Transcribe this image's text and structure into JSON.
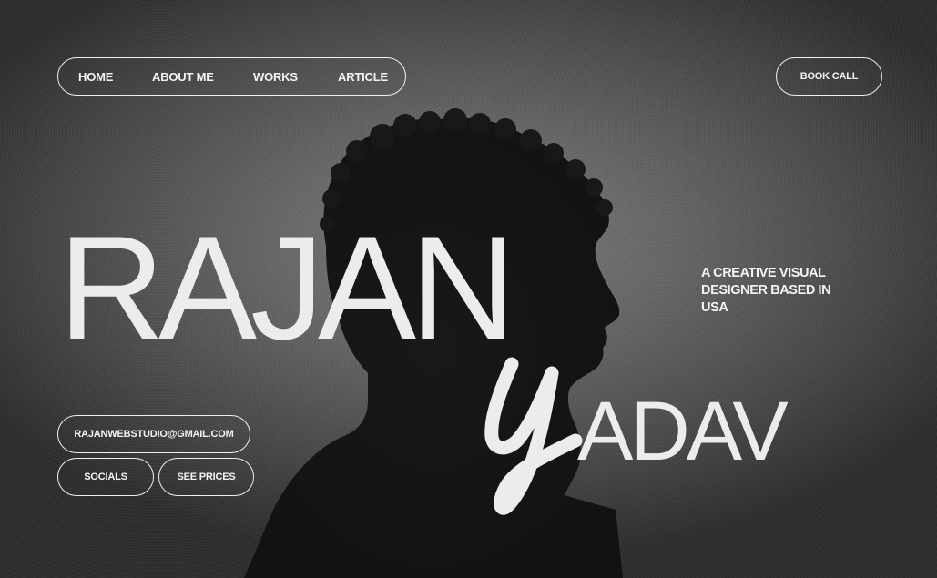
{
  "nav": {
    "items": [
      {
        "label": "HOME"
      },
      {
        "label": "ABOUT ME"
      },
      {
        "label": "WORKS"
      },
      {
        "label": "ARTICLE"
      }
    ],
    "cta_label": "BOOK CALL"
  },
  "hero": {
    "first_name": "RAJAN",
    "last_name_script_letter": "Y",
    "last_name_rest": "ADAV",
    "tagline": "A CREATIVE VISUAL DESIGNER BASED IN USA"
  },
  "contact": {
    "email_label": "RAJANWEBSTUDIO@GMAIL.COM",
    "socials_label": "SOCIALS",
    "prices_label": "SEE PRICES"
  },
  "theme": {
    "background": "#676767",
    "foreground": "#f2f2f2",
    "silhouette": "#141414"
  },
  "decor": {
    "portrait_image": "man-profile-silhouette"
  }
}
